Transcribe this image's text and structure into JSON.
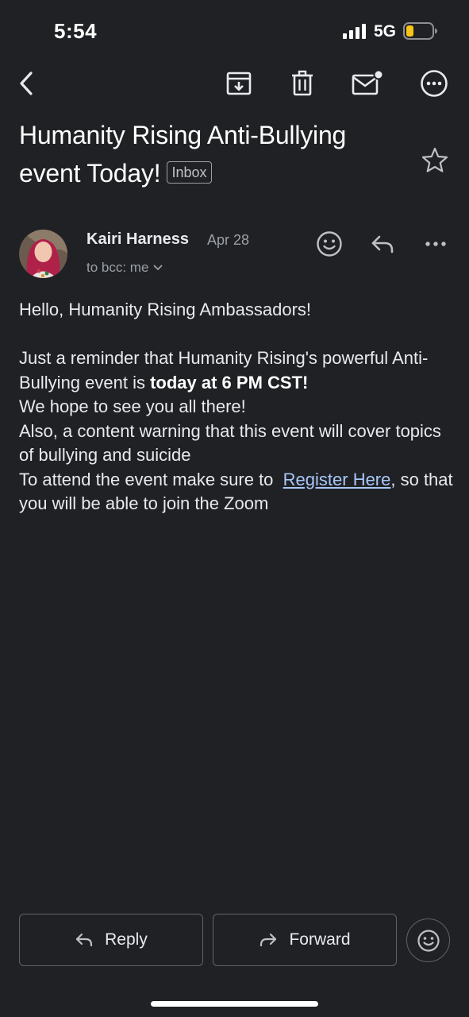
{
  "status_bar": {
    "time": "5:54",
    "network": "5G",
    "battery_color": "#f5c518"
  },
  "toolbar": {
    "back_icon": "chevron-left-icon",
    "archive_icon": "archive-icon",
    "delete_icon": "trash-icon",
    "mark_unread_icon": "mail-unread-icon",
    "more_icon": "more-circle-icon"
  },
  "email": {
    "subject": "Humanity Rising Anti-Bullying event Today!",
    "label": "Inbox",
    "sender": {
      "name": "Kairi Harness",
      "date": "Apr 28",
      "recipients": "to bcc: me"
    },
    "body": {
      "greeting": "Hello, Humanity Rising Ambassadors!",
      "p1_before": "Just a reminder that Humanity Rising's powerful Anti-Bullying event is ",
      "p1_bold": "today at 6 PM CST!",
      "p2": "We hope to see you all there!",
      "p3": "Also, a content warning that this event will cover topics of bullying and suicide",
      "p4_before": "To attend the event make sure to  ",
      "p4_link": "Register Here",
      "p4_after": ", so that you will be able to join the Zoom"
    }
  },
  "actions": {
    "reply_label": "Reply",
    "forward_label": "Forward"
  },
  "colors": {
    "background": "#202124",
    "text": "#e8eaed",
    "muted": "#9aa0a6",
    "link": "#a8c7fa",
    "border": "#5f6368"
  }
}
